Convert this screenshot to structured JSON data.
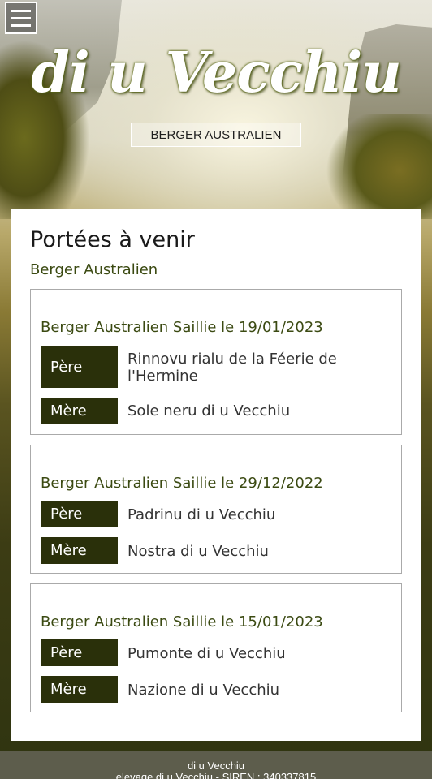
{
  "header": {
    "brand": "di u Vecchiu",
    "breed_button": "BERGER AUSTRALIEN"
  },
  "main": {
    "title": "Portées à venir",
    "subtitle": "Berger Australien",
    "pere_label": "Père",
    "mere_label": "Mère",
    "litters": [
      {
        "title": "Berger Australien Saillie le 19/01/2023",
        "pere": "Rinnovu rialu de la Féerie de l'Hermine",
        "mere": "Sole neru di u Vecchiu"
      },
      {
        "title": "Berger Australien Saillie le 29/12/2022",
        "pere": "Padrinu di u Vecchiu",
        "mere": "Nostra di u Vecchiu"
      },
      {
        "title": "Berger Australien Saillie le 15/01/2023",
        "pere": "Pumonte di u Vecchiu",
        "mere": "Nazione di u Vecchiu"
      }
    ]
  },
  "footer": {
    "line1": "di u Vecchiu",
    "line2": "elevage di u Vecchiu - SIREN : 340337815"
  },
  "colors": {
    "label_bg": "#2a300a",
    "accent_text": "#3b4a12",
    "footer_bg": "#5d5d4c"
  }
}
